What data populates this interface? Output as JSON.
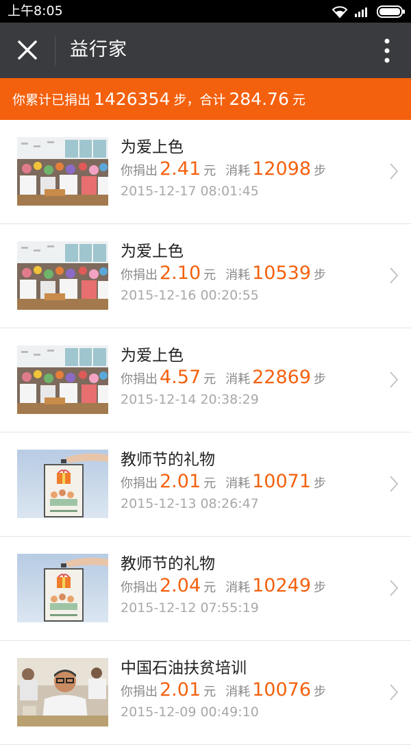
{
  "status_bar": {
    "time": "上午8:05"
  },
  "app_bar": {
    "title": "益行家"
  },
  "banner": {
    "prefix": "你累计已捐出",
    "steps": "1426354",
    "steps_unit": "步，合计",
    "amount": "284.76",
    "amount_unit": "元"
  },
  "labels": {
    "donated": "你捐出",
    "yuan": "元",
    "consumed": "消耗",
    "steps_unit": "步"
  },
  "items": [
    {
      "title": "为爱上色",
      "amount": "2.41",
      "steps": "12098",
      "date": "2015-12-17 08:01:45",
      "image": "classroom-photo"
    },
    {
      "title": "为爱上色",
      "amount": "2.10",
      "steps": "10539",
      "date": "2015-12-16 00:20:55",
      "image": "classroom-photo"
    },
    {
      "title": "为爱上色",
      "amount": "4.57",
      "steps": "22869",
      "date": "2015-12-14 20:38:29",
      "image": "classroom-photo"
    },
    {
      "title": "教师节的礼物",
      "amount": "2.01",
      "steps": "10071",
      "date": "2015-12-13 08:26:47",
      "image": "gift-card-photo"
    },
    {
      "title": "教师节的礼物",
      "amount": "2.04",
      "steps": "10249",
      "date": "2015-12-12 07:55:19",
      "image": "gift-card-photo"
    },
    {
      "title": "中国石油扶贫培训",
      "amount": "2.01",
      "steps": "10076",
      "date": "2015-12-09 00:49:10",
      "image": "teacher-photo"
    }
  ],
  "colors": {
    "accent": "#f4610e",
    "appbar": "#3a3b3f"
  }
}
